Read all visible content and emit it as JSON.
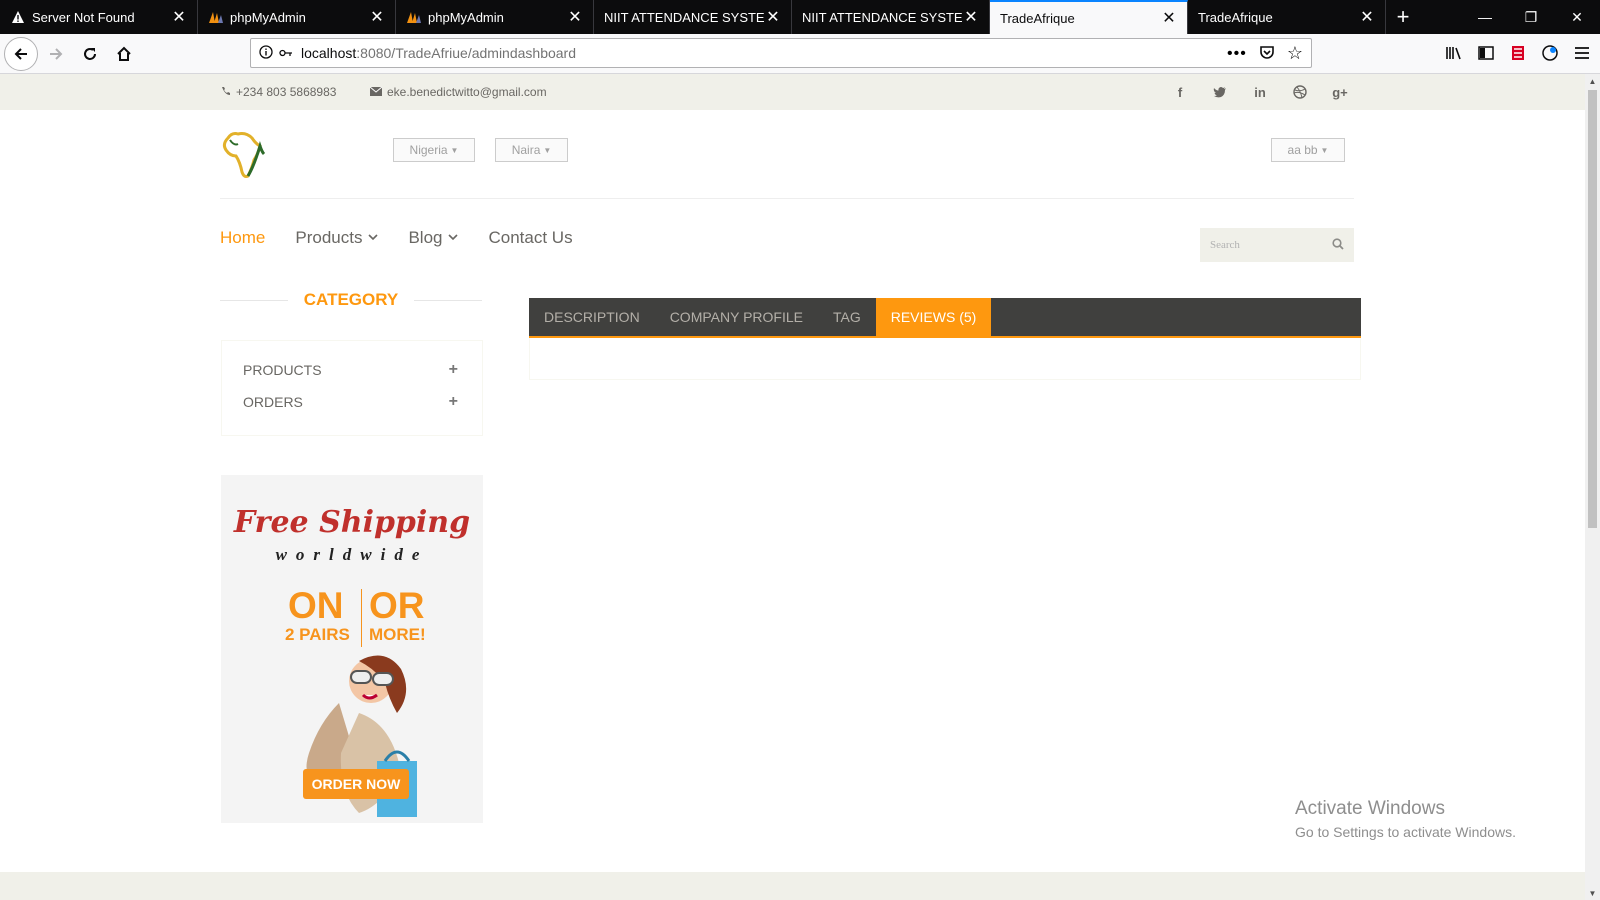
{
  "browser": {
    "tabs": [
      {
        "title": "Server Not Found",
        "icon": "warning-icon"
      },
      {
        "title": "phpMyAdmin",
        "icon": "phpmyadmin-icon"
      },
      {
        "title": "phpMyAdmin",
        "icon": "phpmyadmin-icon"
      },
      {
        "title": "NIIT ATTENDANCE SYSTEM",
        "icon": ""
      },
      {
        "title": "NIIT ATTENDANCE SYSTEM",
        "icon": ""
      },
      {
        "title": "TradeAfrique",
        "icon": "",
        "active": true
      },
      {
        "title": "TradeAfrique",
        "icon": ""
      }
    ],
    "url_host": "localhost",
    "url_path": ":8080/TradeAfriue/admindashboard"
  },
  "topbar": {
    "phone": "+234 803 5868983",
    "email": "eke.benedictwitto@gmail.com",
    "social": [
      "f",
      "t",
      "in",
      "dribbble-icon",
      "g+"
    ]
  },
  "header": {
    "country": "Nigeria",
    "currency": "Naira",
    "account": "aa bb"
  },
  "menu": {
    "home": "Home",
    "products": "Products",
    "blog": "Blog",
    "contact": "Contact Us",
    "search_placeholder": "Search"
  },
  "sidebar": {
    "title": "CATEGORY",
    "items": [
      {
        "label": "PRODUCTS"
      },
      {
        "label": "ORDERS"
      }
    ]
  },
  "promo": {
    "headline": "Free Shipping",
    "sub": "worldwide",
    "on": "ON",
    "or": "OR",
    "pairs": "2 PAIRS",
    "more": "MORE!",
    "cta": "ORDER NOW"
  },
  "product_tabs": {
    "description": "DESCRIPTION",
    "company_profile": "COMPANY PROFILE",
    "tag": "TAG",
    "reviews": "REVIEWS (5)"
  },
  "windows_watermark": {
    "line1": "Activate Windows",
    "line2": "Go to Settings to activate Windows."
  },
  "colors": {
    "accent": "#fe980f",
    "tab_bar": "#40403e",
    "topbar": "#f0f0e9"
  }
}
